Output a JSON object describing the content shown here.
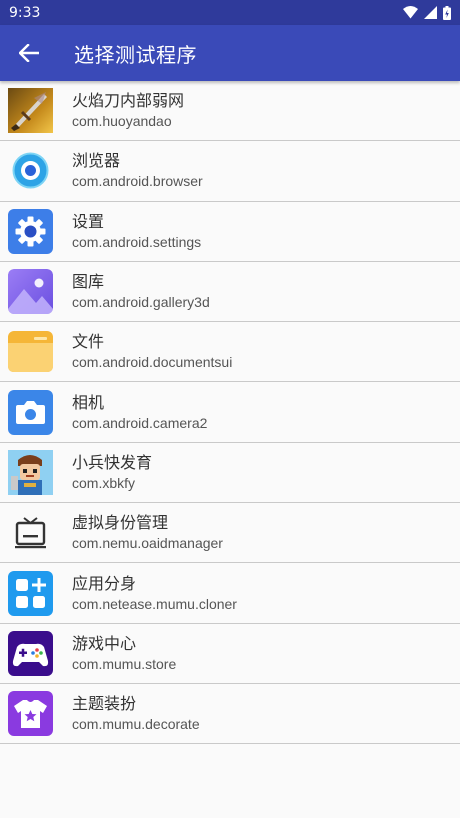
{
  "status_bar": {
    "time": "9:33"
  },
  "app_bar": {
    "title": "选择测试程序",
    "back_icon": "arrow-left-icon"
  },
  "apps": [
    {
      "name": "火焰刀内部弱网",
      "package": "com.huoyandao",
      "icon": "game-sword-icon"
    },
    {
      "name": "浏览器",
      "package": "com.android.browser",
      "icon": "browser-icon"
    },
    {
      "name": "设置",
      "package": "com.android.settings",
      "icon": "gear-icon"
    },
    {
      "name": "图库",
      "package": "com.android.gallery3d",
      "icon": "gallery-icon"
    },
    {
      "name": "文件",
      "package": "com.android.documentsui",
      "icon": "folder-icon"
    },
    {
      "name": "相机",
      "package": "com.android.camera2",
      "icon": "camera-icon"
    },
    {
      "name": "小兵快发育",
      "package": "com.xbkfy",
      "icon": "game-soldier-icon"
    },
    {
      "name": "虚拟身份管理",
      "package": "com.nemu.oaidmanager",
      "icon": "tv-icon"
    },
    {
      "name": "应用分身",
      "package": "com.netease.mumu.cloner",
      "icon": "app-grid-plus-icon"
    },
    {
      "name": "游戏中心",
      "package": "com.mumu.store",
      "icon": "gamepad-icon"
    },
    {
      "name": "主题装扮",
      "package": "com.mumu.decorate",
      "icon": "tshirt-star-icon"
    }
  ]
}
